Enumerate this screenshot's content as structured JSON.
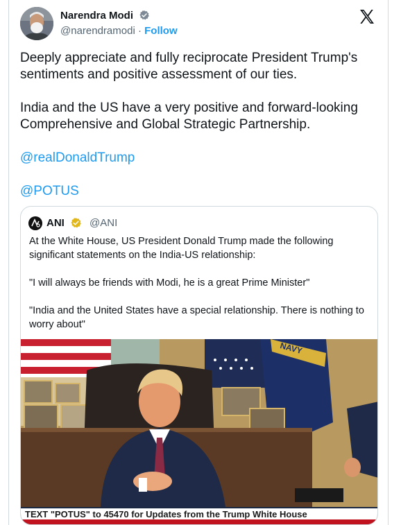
{
  "author": {
    "name": "Narendra Modi",
    "handle": "@narendramodi",
    "separator": "·",
    "follow_label": "Follow"
  },
  "icons": {
    "verified": "verified-badge-icon",
    "platform": "x-logo-icon",
    "quote_badge": "gold-verified-badge-icon"
  },
  "colors": {
    "link": "#1d9bf0",
    "text": "#0f1419",
    "secondary": "#536471",
    "border": "#cfd9de"
  },
  "tweet": {
    "paragraph_1": "Deeply appreciate and fully reciprocate President Trump's sentiments and positive assessment of our ties.",
    "paragraph_2": "India and the US have a very positive and forward-looking Comprehensive and Global Strategic Partnership.",
    "mention_1": "@realDonaldTrump",
    "mention_2": "@POTUS"
  },
  "quoted": {
    "name": "ANI",
    "handle": "@ANI",
    "paragraph_1": "At the White House, US President Donald Trump made the following significant statements on the India-US relationship:",
    "paragraph_2": "\"I will always be friends with Modi, he is a great Prime Minister\"",
    "paragraph_3": "\"India and the United States have a special relationship. There is nothing to worry about\"",
    "media": {
      "flag_text": "NAVY",
      "caption": "TEXT \"POTUS\" to 45470 for Updates from the Trump White House"
    }
  }
}
